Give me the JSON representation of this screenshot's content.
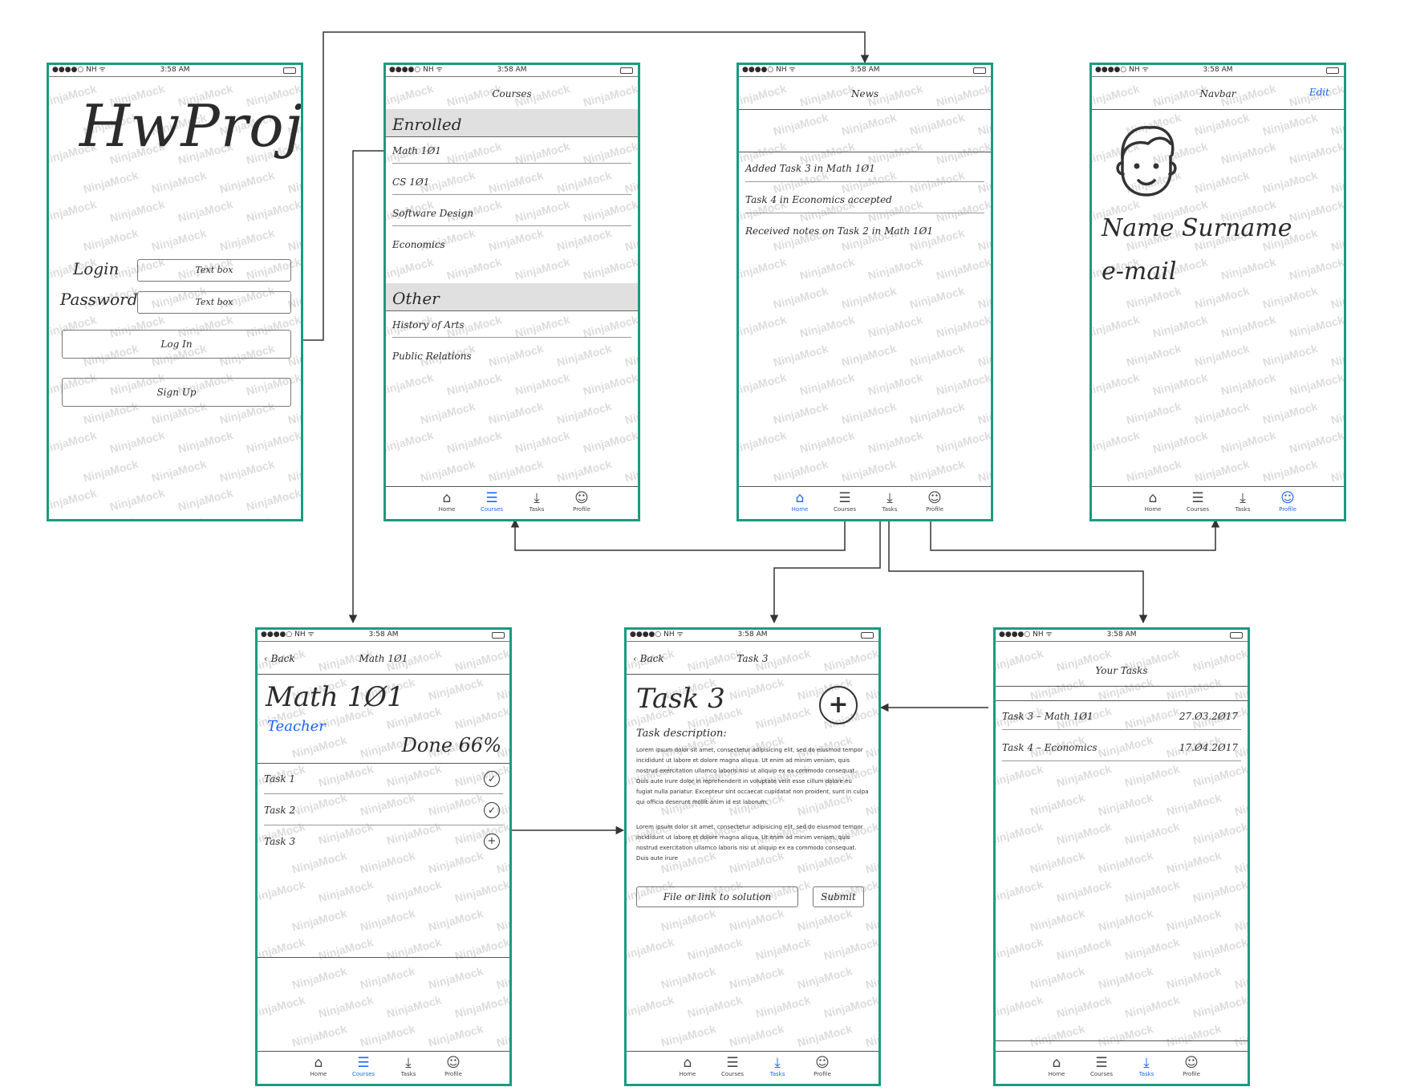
{
  "status": {
    "carrier": "●●●●○ NH ᯤ",
    "time": "3:58 AM"
  },
  "watermark": "NinjaMock",
  "tabs": {
    "home": "Home",
    "courses": "Courses",
    "tasks": "Tasks",
    "profile": "Profile"
  },
  "login": {
    "app_title": "HwProj",
    "login_label": "Login",
    "password_label": "Password",
    "login_box": "Text box",
    "password_box": "Text box",
    "login_button": "Log In",
    "signup_button": "Sign Up"
  },
  "courses": {
    "title": "Courses",
    "enrolled_header": "Enrolled",
    "enrolled": [
      "Math 1Ø1",
      "CS 1Ø1",
      "Software Design",
      "Economics"
    ],
    "other_header": "Other",
    "other": [
      "History of Arts",
      "Public Relations"
    ]
  },
  "news": {
    "title": "News",
    "items": [
      "Added Task 3 in Math 1Ø1",
      "Task 4 in Economics accepted",
      "Received notes on Task 2 in Math 1Ø1"
    ]
  },
  "profile": {
    "title": "Navbar",
    "edit": "Edit",
    "name": "Name Surname",
    "email": "e-mail"
  },
  "course_detail": {
    "back": "Back",
    "title": "Math 1Ø1",
    "heading": "Math 1Ø1",
    "teacher": "Teacher",
    "done": "Done 66%",
    "tasks": [
      "Task 1",
      "Task 2",
      "Task 3"
    ]
  },
  "task_detail": {
    "back": "Back",
    "title": "Task 3",
    "heading": "Task 3",
    "desc_label": "Task description:",
    "para1": "Lorem ipsum dolor sit amet, consectetur adipisicing elit, sed do eiusmod tempor incididunt ut labore et dolore magna aliqua. Ut enim ad minim veniam, quis nostrud exercitation ullamco laboris nisi ut aliquip ex ea commodo consequat. Duis aute irure dolor in reprehenderit in voluptate velit esse cillum dolore eu fugiat nulla pariatur. Excepteur sint occaecat cupidatat non proident, sunt in culpa qui officia deserunt mollit anim id est laborum.",
    "para2": "Lorem ipsum dolor sit amet, consectetur adipisicing elit, sed do eiusmod tempor incididunt ut labore et dolore magna aliqua. Ut enim ad minim veniam, quis nostrud exercitation ullamco laboris nisi ut aliquip ex ea commodo consequat. Duis aute irure",
    "file_placeholder": "File or link to solution",
    "submit": "Submit"
  },
  "your_tasks": {
    "title": "Your Tasks",
    "items": [
      {
        "name": "Task 3 – Math 1Ø1",
        "date": "27.Ø3.2Ø17"
      },
      {
        "name": "Task 4 – Economics",
        "date": "17.Ø4.2Ø17"
      }
    ]
  }
}
